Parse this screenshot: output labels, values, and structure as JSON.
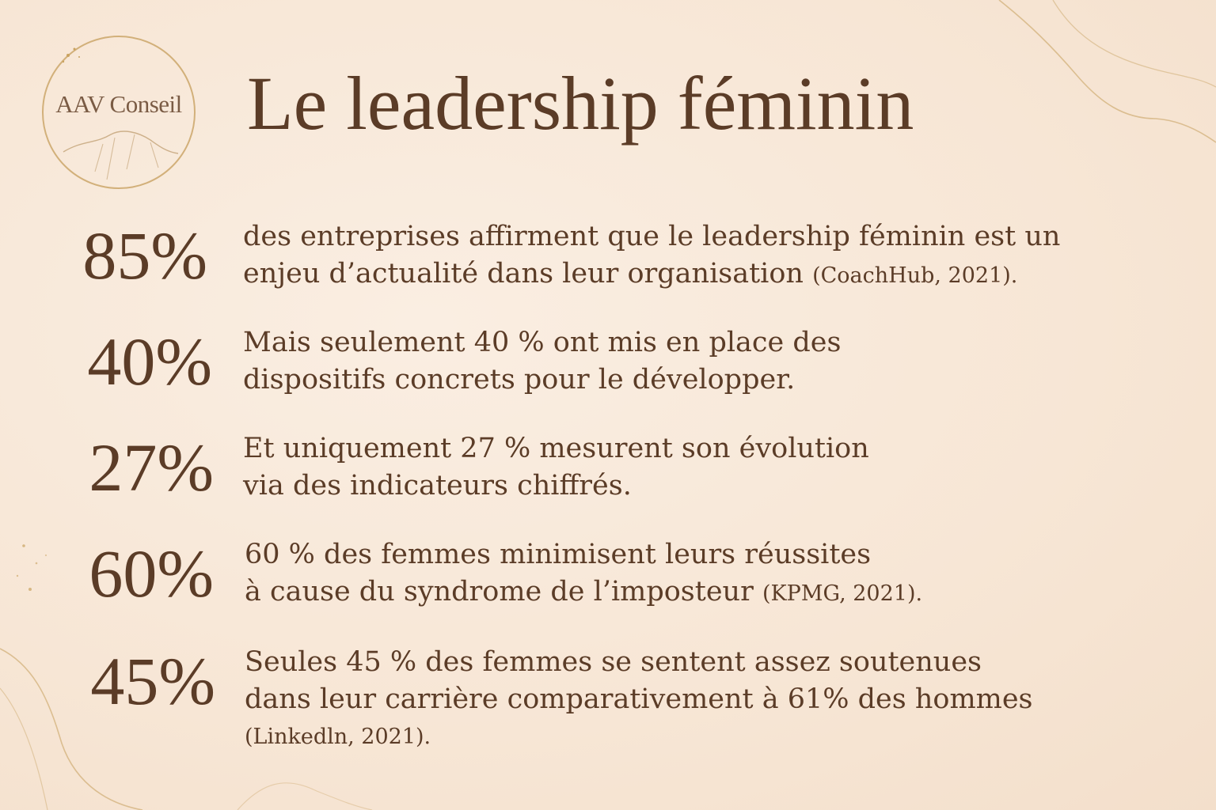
{
  "colors": {
    "background": "#f8e8d9",
    "text": "#5b3c27",
    "gold_accent": "#d2b07a"
  },
  "logo": {
    "text": "AAV Conseil"
  },
  "title": "Le leadership féminin",
  "stats": [
    {
      "percent": "85%",
      "line1": "des entreprises affirment que le leadership féminin est un",
      "line2": "enjeu d’actualité dans leur organisation",
      "source": "(CoachHub, 2021)."
    },
    {
      "percent": "40%",
      "line1": "Mais seulement 40 % ont mis en place des",
      "line2": "dispositifs concrets pour le développer."
    },
    {
      "percent": "27%",
      "line1": "Et uniquement 27 % mesurent son évolution",
      "line2": "via des indicateurs chiffrés."
    },
    {
      "percent": "60%",
      "line1": "60 % des femmes minimisent leurs réussites",
      "line2": "à cause du syndrome de l’imposteur",
      "source": "(KPMG, 2021)."
    },
    {
      "percent": "45%",
      "line1": "Seules 45 % des femmes se sentent assez soutenues",
      "line2": "dans leur carrière comparativement à 61% des hommes",
      "line3": "(Linkedln, 2021)."
    }
  ]
}
